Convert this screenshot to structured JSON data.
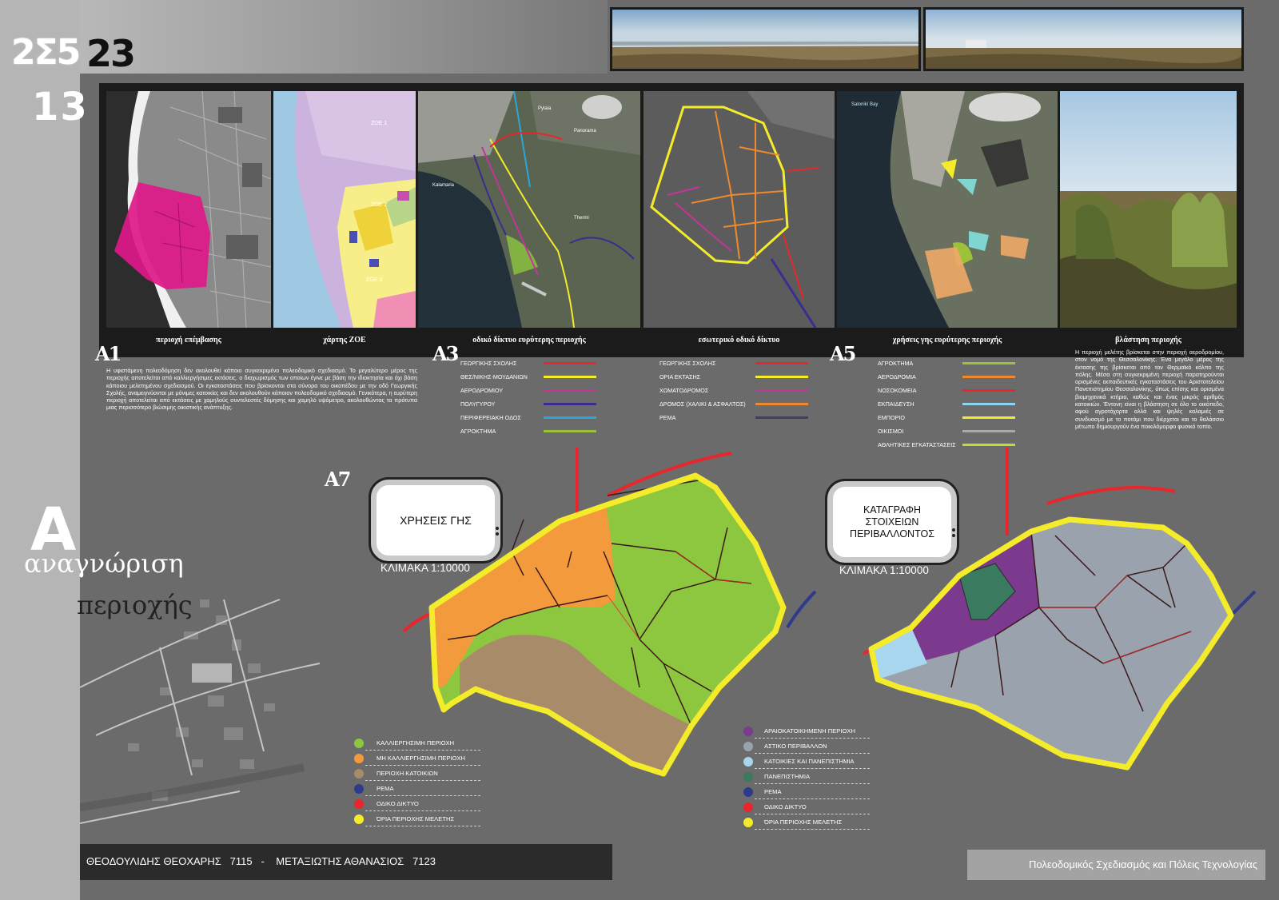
{
  "header": {
    "code_left": "2Σ5",
    "code_right": "23",
    "sheet_number": "13"
  },
  "top_photos": [
    {
      "name": "panorama-shoreline"
    },
    {
      "name": "panorama-field"
    }
  ],
  "panels": {
    "captions": [
      "περιοχή επέμβασης",
      "χάρτης ΖΟΕ",
      "οδικό δίκτυο ευρύτερης περιοχής",
      "εσωτερικό οδικό δίκτυο",
      "χρήσεις γης ευρύτερης περιοχής",
      "βλάστηση περιοχής"
    ],
    "zoe_labels": [
      "ΖΟΕ 1",
      "ΖΟΕ 2",
      "ΖΟΕ 3"
    ],
    "map_labels": [
      "Kalamaria",
      "Pylaia",
      "Panorama",
      "Thermi",
      "Salonikí Bay"
    ]
  },
  "sections": {
    "a1": {
      "label": "A1",
      "text": "Η υφιστάμενη πολεοδόμηση δεν ακολουθεί κάποιο συγκεκριμένο πολεοδομικό σχεδιασμό. Το μεγαλύτερο μέρος της περιοχής αποτελείται από καλλιεργήσιμες εκτάσεις. ο διαχωρισμός των οποίων έγινε με βάση την ιδιοκτησία και όχι βάση κάποιου μελετημένου σχεδιασμού. Οι εγκαταστάσεις που βρίσκονται στα σύνορα του οικοπέδου με την οδό Γεωργικής Σχολής, αναμειγνύονται με μόνιμες κατοικίες και δεν ακολουθούν κάποιον πολεοδομικό σχεδιασμό. Γενικότερα, η ευρύτερη περιοχή αποτελείται από εκτάσεις με χαμηλούς συντελεστές δόμησης και χαμηλό υψόμετρο, ακολουθώντας τα πρότυπα μιας περισσότερο βιώσιμης οικιστικής ανάπτυξης."
    },
    "a3": {
      "label": "A3",
      "legend": [
        {
          "label": "ΓΕΩΡΓΙΚΗΣ ΣΧΟΛΗΣ",
          "color": "#e8262b"
        },
        {
          "label": "ΘΕΣ/ΝΙΚΗΣ-ΜΟΥΔΑΝΙΩΝ",
          "color": "#f4ec2a"
        },
        {
          "label": "ΑΕΡΟΔΡΟΜΙΟΥ",
          "color": "#c2359a"
        },
        {
          "label": "ΠΟΛΥΓΥΡΟΥ",
          "color": "#3a2d8f"
        },
        {
          "label": "ΠΕΡΙΦΕΡΕΙΑΚΗ ΟΔΟΣ",
          "color": "#2aa6d9"
        },
        {
          "label": "ΑΓΡΟΚΤΗΜΑ",
          "color": "#9cc23a"
        }
      ]
    },
    "a4": {
      "legend": [
        {
          "label": "ΓΕΩΡΓΙΚΗΣ ΣΧΟΛΗΣ",
          "color": "#e8262b"
        },
        {
          "label": "ΟΡΙΑ ΕΚΤΑΣΗΣ",
          "color": "#f4ec2a"
        },
        {
          "label": "ΧΩΜΑΤΟΔΡΟΜΟΣ",
          "color": "#c2359a"
        },
        {
          "label": "ΔΡΟΜΟΣ (ΧΑΛΙΚΙ & ΑΣΦΑΛΤΟΣ)",
          "color": "#ee8a2d"
        },
        {
          "label": "ΡΕΜΑ",
          "color": "#3d3d6a"
        }
      ]
    },
    "a5": {
      "label": "A5",
      "legend": [
        {
          "label": "ΑΓΡΟΚΤΗΜΑ",
          "color": "#9cc23a"
        },
        {
          "label": "ΑΕΡΟΔΡΟΜΙΑ",
          "color": "#ee8a2d"
        },
        {
          "label": "ΝΟΣΟΚΟΜΕΙΑ",
          "color": "#e8262b"
        },
        {
          "label": "ΕΚΠΑΙΔΕΥΣΗ",
          "color": "#8fd3ee"
        },
        {
          "label": "ΕΜΠΟΡΙΟ",
          "color": "#f4ec2a"
        },
        {
          "label": "ΟΙΚΙΣΜΟΙ",
          "color": "#a9a9a9"
        },
        {
          "label": "ΑΘΛΗΤΙΚΕΣ ΕΓΚΑΤΑΣΤΑΣΕΙΣ",
          "color": "#bedb3c"
        }
      ]
    },
    "a6": {
      "text": "Η περιοχή μελέτης βρίσκεται στην περιοχή αεροδρομίου, στον νομό της Θεσσαλονίκης. Ένα μεγάλο μέρος της έκτασης της βρίσκεται από τον Θερμαϊκό κόλπο της πόλης. Μέσα στη συγκεκριμένη περιοχή παρατηρούνται ορισμένες εκπαιδευτικές εγκαταστάσεις του Αριστοτελείου Πανεπιστημίου Θεσσαλονίκης, όπως επίσης και ορισμένα βιομηχανικά κτήρια, καθώς και ένας μικρός αριθμός κατοικιών. Έντονη είναι η βλάστηση σε όλο το οικόπεδο, αφού αγροτόχορτα αλλά και ψηλές καλαμιές σε συνδυασμό με το ποτάμι που διέρχεται και το θαλάσσιο μέτωπο δημιουργούν ένα ποικιλόμορφο φυσικό τοπίο."
    },
    "a7": {
      "label": "A7"
    }
  },
  "side_title": {
    "letter": "A",
    "line1": "αναγνώριση",
    "line2": "περιοχής"
  },
  "map1": {
    "title": "ΧΡΗΣΕΙΣ ΓΗΣ",
    "scale": "ΚΛΙΜΑΚΑ 1:10000",
    "legend": [
      {
        "label": "ΚΑΛΛΙΕΡΓΗΣΙΜΗ ΠΕΡΙΟΧΗ",
        "color": "#8dc63f"
      },
      {
        "label": "ΜΗ ΚΑΛΛΙΕΡΓΗΣΙΜΗ ΠΕΡΙΟΧΗ",
        "color": "#f39a3c"
      },
      {
        "label": "ΠΕΡΙΟΧΗ ΚΑΤΟΙΚΙΩΝ",
        "color": "#a88c6a"
      },
      {
        "label": "ΡΕΜΑ",
        "color": "#2e3a8c"
      },
      {
        "label": "ΟΔΙΚΟ ΔΙΚΤΥΟ",
        "color": "#e8262b"
      },
      {
        "label": "ΌΡΙΑ ΠΕΡΙΟΧΗΣ ΜΕΛΕΤΗΣ",
        "color": "#f4ec2a"
      }
    ]
  },
  "map2": {
    "title": "ΚΑΤΑΓΡΑΦΗ ΣΤΟΙΧΕΙΩΝ ΠΕΡΙΒΑΛΛΟΝΤΟΣ",
    "title_lines": [
      "ΚΑΤΑΓΡΑΦΗ",
      "ΣΤΟΙΧΕΙΩΝ",
      "ΠΕΡΙΒΑΛΛΟΝΤΟΣ"
    ],
    "scale": "ΚΛΙΜΑΚΑ 1:10000",
    "legend": [
      {
        "label": "ΑΡΑΙΟΚΑΤΟΙΚΗΜΕΝΗ ΠΕΡΙΟΧΗ",
        "color": "#7b3a8e"
      },
      {
        "label": "ΑΣΤΙΚΟ ΠΕΡΙΒΑΛΛΟΝ",
        "color": "#9aa3ad"
      },
      {
        "label": "ΚΑΤΟΙΚΙΕΣ ΚΑΙ ΠΑΝΕΠΙΣΤΗΜΙΑ",
        "color": "#a7d6ee"
      },
      {
        "label": "ΠΑΝΕΠΙΣΤΗΜΙΑ",
        "color": "#3a7a5e"
      },
      {
        "label": "ΡΕΜΑ",
        "color": "#2e3a8c"
      },
      {
        "label": "ΟΔΙΚΟ ΔΙΚΤΥΟ",
        "color": "#e8262b"
      },
      {
        "label": "ΌΡΙΑ ΠΕΡΙΟΧΗΣ ΜΕΛΕΤΗΣ",
        "color": "#f4ec2a"
      }
    ]
  },
  "footer": {
    "author1": "ΘΕΟΔΟΥΛΙΔΗΣ ΘΕΟΧΑΡΗΣ",
    "id1": "7115",
    "sep": "-",
    "author2": "ΜΕΤΑΞΙΩΤΗΣ ΑΘΑΝΑΣΙΟΣ",
    "id2": "7123",
    "course": "Πολεοδομικός Σχεδιασμός και Πόλεις Τεχνολογίας"
  },
  "icons": [
    "tv-frame-icon",
    "speaker-dots-icon"
  ]
}
